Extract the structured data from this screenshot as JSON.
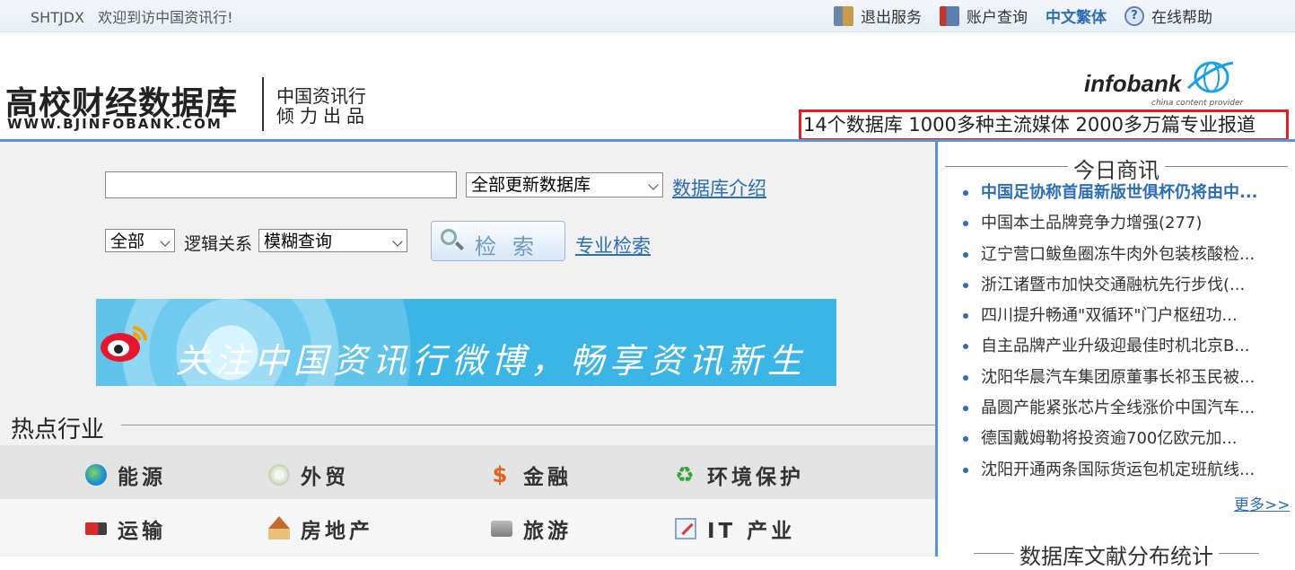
{
  "topbar": {
    "account": "SHTJDX",
    "welcome": "欢迎到访中国资讯行!",
    "links": [
      {
        "label": "退出服务",
        "icon": "exit-icon"
      },
      {
        "label": "账户查询",
        "icon": "account-icon"
      },
      {
        "label": "中文繁体",
        "icon": ""
      },
      {
        "label": "在线帮助",
        "icon": "help-icon"
      }
    ]
  },
  "header": {
    "logo_title": "高校财经数据库",
    "logo_url": "WWW.BJINFOBANK.COM",
    "logo_sub_line1": "中国资讯行",
    "logo_sub_line2": "倾力出品",
    "brand": "infobank",
    "brand_tagline": "china content provider",
    "slogan": "14个数据库 1000多种主流媒体 2000多万篇专业报道"
  },
  "search": {
    "query_value": "",
    "db_select": "全部更新数据库",
    "db_intro_link": "数据库介绍",
    "scope_select": "全部",
    "logic_label": "逻辑关系",
    "mode_select": "模糊查询",
    "search_button": "检索",
    "advanced_link": "专业检索"
  },
  "banner": {
    "text": "关注中国资讯行微博，畅享资讯新生活！"
  },
  "hot": {
    "title": "热点行业",
    "industries": [
      {
        "label": "能源",
        "icon": "globe-icon"
      },
      {
        "label": "外贸",
        "icon": "trade-icon"
      },
      {
        "label": "金融",
        "icon": "dollar-icon"
      },
      {
        "label": "环境保护",
        "icon": "recycle-icon"
      },
      {
        "label": "运输",
        "icon": "truck-icon"
      },
      {
        "label": "房地产",
        "icon": "house-icon"
      },
      {
        "label": "旅游",
        "icon": "camera-icon"
      },
      {
        "label": "IT 产业",
        "icon": "pen-icon"
      }
    ]
  },
  "news": {
    "title": "今日商讯",
    "items": [
      "中国足协称首届新版世俱杯仍将由中...",
      "中国本土品牌竞争力增强(277)",
      "辽宁营口鲅鱼圈冻牛肉外包装核酸检...",
      "浙江诸暨市加快交通融杭先行步伐(...",
      "四川提升畅通\"双循环\"门户枢纽功...",
      "自主品牌产业升级迎最佳时机北京B...",
      "沈阳华晨汽车集团原董事长祁玉民被...",
      "晶圆产能紧张芯片全线涨价中国汽车...",
      "德国戴姆勒将投资逾700亿欧元加...",
      "沈阳开通两条国际货运包机定班航线..."
    ],
    "more": "更多>>",
    "stats_title": "数据库文献分布统计"
  },
  "colors": {
    "accent": "#2c6db5",
    "divider": "#5b95cf",
    "slogan_border": "#e02020"
  }
}
